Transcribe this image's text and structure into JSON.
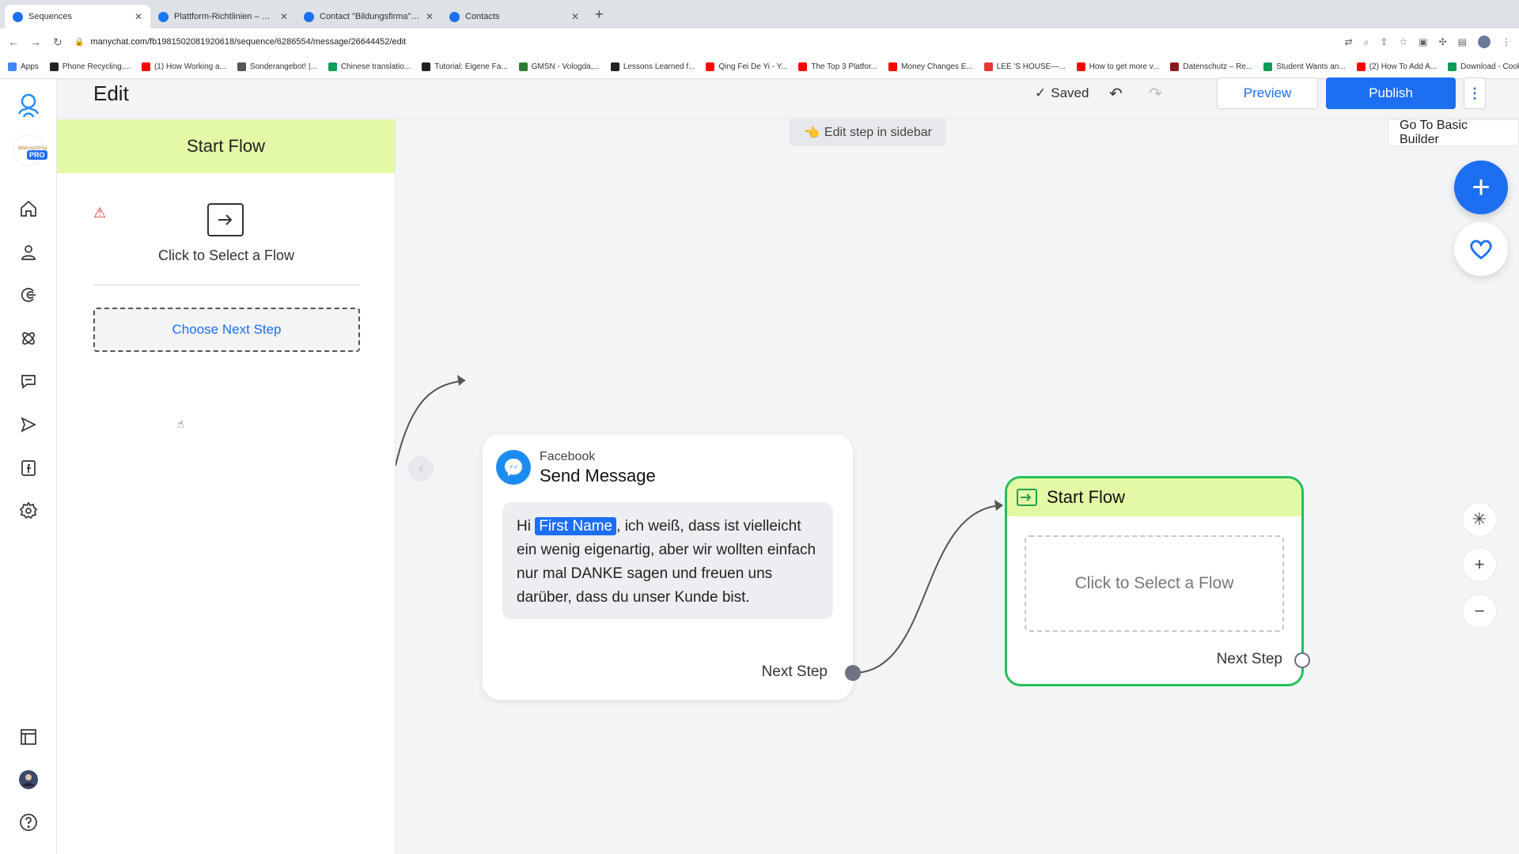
{
  "browser": {
    "tabs": [
      {
        "title": "Sequences",
        "active": true,
        "favicon_color": "#1d6ff2"
      },
      {
        "title": "Plattform-Richtlinien – Übersicht",
        "active": false,
        "favicon_color": "#1877f2"
      },
      {
        "title": "Contact \"Bildungsfirma\" through",
        "active": false,
        "favicon_color": "#1d6ff2"
      },
      {
        "title": "Contacts",
        "active": false,
        "favicon_color": "#1d6ff2"
      }
    ],
    "url": "manychat.com/fb198150208192061​8/sequence/6286554/message/26644452/edit",
    "bookmarks": [
      {
        "label": "Apps",
        "color": "#4285f4"
      },
      {
        "label": "Phone Recycling,...",
        "color": "#222222"
      },
      {
        "label": "(1) How Working a...",
        "color": "#ff0000"
      },
      {
        "label": "Sonderangebot! |...",
        "color": "#555555"
      },
      {
        "label": "Chinese translatio...",
        "color": "#0f9d58"
      },
      {
        "label": "Tutorial: Eigene Fa...",
        "color": "#222222"
      },
      {
        "label": "GMSN - Vologda,...",
        "color": "#2e7d32"
      },
      {
        "label": "Lessons Learned f...",
        "color": "#222222"
      },
      {
        "label": "Qing Fei De Yi - Y...",
        "color": "#ff0000"
      },
      {
        "label": "The Top 3 Platfor...",
        "color": "#ff0000"
      },
      {
        "label": "Money Changes E...",
        "color": "#ff0000"
      },
      {
        "label": "LEE 'S HOUSE—...",
        "color": "#e53935"
      },
      {
        "label": "How to get more v...",
        "color": "#ff0000"
      },
      {
        "label": "Datenschutz – Re...",
        "color": "#8b1a1a"
      },
      {
        "label": "Student Wants an...",
        "color": "#0f9d58"
      },
      {
        "label": "(2) How To Add A...",
        "color": "#ff0000"
      },
      {
        "label": "Download - Cooki...",
        "color": "#0f9d58"
      }
    ]
  },
  "leftnav": {
    "pro_badge": "PRO",
    "account_text": "Bildungsfirma",
    "icons": [
      "home-icon",
      "contacts-icon",
      "growth-tools-icon",
      "automation-icon",
      "live-chat-icon",
      "broadcast-icon",
      "facebook-page-icon",
      "settings-icon",
      "templates-icon",
      "user-avatar",
      "help-icon"
    ]
  },
  "header": {
    "title": "Edit",
    "saved_label": "Saved",
    "preview_label": "Preview",
    "publish_label": "Publish",
    "more_label": "⋮"
  },
  "sidebar": {
    "title": "Start Flow",
    "select_flow_label": "Click to Select a Flow",
    "next_step_label": "Choose Next Step"
  },
  "canvas": {
    "hint": "Edit step in sidebar",
    "basic_builder_label": "Go To Basic Builder",
    "message_node": {
      "platform": "Facebook",
      "title": "Send Message",
      "text_before": "Hi ",
      "variable": "First Name",
      "text_after": ", ich weiß, dass ist vielleicht ein wenig eigenartig, aber wir wollten einfach nur mal DANKE sagen und freuen uns darüber, dass du unser Kunde bist.",
      "next_step_label": "Next Step"
    },
    "flow_node": {
      "title": "Start Flow",
      "select_flow_label": "Click to Select a Flow",
      "next_step_label": "Next Step"
    }
  },
  "colors": {
    "accent": "#1d6ff2",
    "start_flow_header": "#e4f9a6",
    "selected_border": "#22c05b"
  }
}
